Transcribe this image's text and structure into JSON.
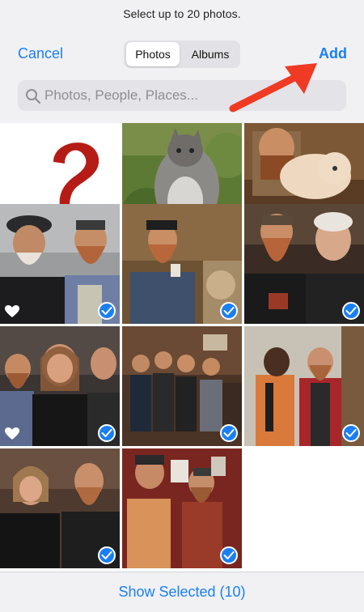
{
  "header": {
    "subtitle": "Select up to 20 photos.",
    "cancel_label": "Cancel",
    "add_label": "Add",
    "tabs": [
      {
        "label": "Photos",
        "active": true
      },
      {
        "label": "Albums",
        "active": false
      }
    ],
    "search_placeholder": "Photos, People, Places..."
  },
  "photos": [
    {
      "id": "1",
      "favorite": true,
      "selected": false
    },
    {
      "id": "2",
      "favorite": true,
      "selected": true
    },
    {
      "id": "3",
      "favorite": false,
      "selected": true
    },
    {
      "id": "4",
      "favorite": true,
      "selected": true
    },
    {
      "id": "5",
      "favorite": false,
      "selected": true
    },
    {
      "id": "6",
      "favorite": false,
      "selected": true
    },
    {
      "id": "7",
      "favorite": true,
      "selected": true
    },
    {
      "id": "8",
      "favorite": false,
      "selected": true
    },
    {
      "id": "9",
      "favorite": false,
      "selected": true
    },
    {
      "id": "10",
      "favorite": false,
      "selected": true
    },
    {
      "id": "11",
      "favorite": false,
      "selected": true
    }
  ],
  "footer": {
    "show_selected_label": "Show Selected (10)"
  },
  "colors": {
    "accent": "#1a7ff5",
    "annotation_arrow": "#ef3b24"
  }
}
